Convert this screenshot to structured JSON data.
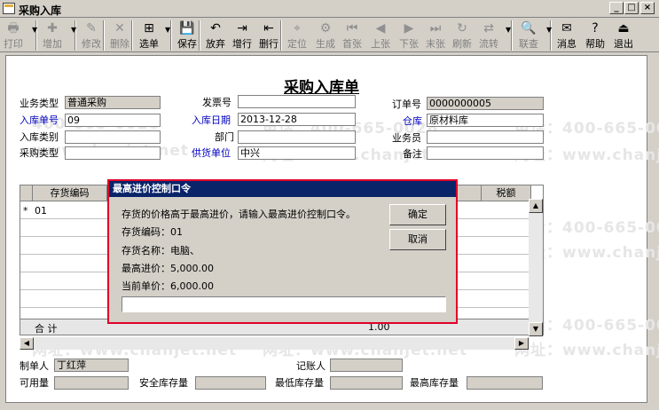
{
  "window": {
    "title": "采购入库",
    "buttons": [
      "_",
      "□",
      "×"
    ]
  },
  "toolbar": [
    {
      "label": "打印",
      "icon": "🖶",
      "enabled": false
    },
    {
      "label": "增加",
      "icon": "✚",
      "enabled": false
    },
    {
      "label": "修改",
      "icon": "✎",
      "enabled": false
    },
    {
      "label": "删除",
      "icon": "✕",
      "enabled": false
    },
    {
      "label": "选单",
      "icon": "⊞",
      "enabled": true
    },
    {
      "label": "保存",
      "icon": "💾",
      "enabled": true
    },
    {
      "label": "放弃",
      "icon": "↶",
      "enabled": true
    },
    {
      "label": "增行",
      "icon": "⇥",
      "enabled": true
    },
    {
      "label": "删行",
      "icon": "⇤",
      "enabled": true
    },
    {
      "label": "定位",
      "icon": "⌖",
      "enabled": false
    },
    {
      "label": "生成",
      "icon": "⚙",
      "enabled": false
    },
    {
      "label": "首张",
      "icon": "⏮",
      "enabled": false
    },
    {
      "label": "上张",
      "icon": "◀",
      "enabled": false
    },
    {
      "label": "下张",
      "icon": "▶",
      "enabled": false
    },
    {
      "label": "末张",
      "icon": "⏭",
      "enabled": false
    },
    {
      "label": "刷新",
      "icon": "↻",
      "enabled": false
    },
    {
      "label": "流转",
      "icon": "⇄",
      "enabled": false
    },
    {
      "label": "联查",
      "icon": "🔍",
      "enabled": false
    },
    {
      "label": "消息",
      "icon": "✉",
      "enabled": true
    },
    {
      "label": "帮助",
      "icon": "?",
      "enabled": true
    },
    {
      "label": "退出",
      "icon": "⏏",
      "enabled": true
    }
  ],
  "form": {
    "title": "采购入库单",
    "business_type_label": "业务类型",
    "business_type": "普通采购",
    "invoice_no_label": "发票号",
    "invoice_no": "",
    "order_no_label": "订单号",
    "order_no": "0000000005",
    "receipt_no_label": "入库单号",
    "receipt_no": "09",
    "receipt_date_label": "入库日期",
    "receipt_date": "2013-12-28",
    "warehouse_label": "仓库",
    "warehouse": "原材料库",
    "receipt_category_label": "入库类别",
    "receipt_category": "",
    "department_label": "部门",
    "department": "",
    "salesperson_label": "业务员",
    "salesperson": "",
    "purchase_type_label": "采购类型",
    "purchase_type": "",
    "supplier_label": "供货单位",
    "supplier": "中兴",
    "remark_label": "备注",
    "remark": ""
  },
  "grid": {
    "headers": [
      "存货编码",
      "税额"
    ],
    "first_row": {
      "marker": "*",
      "code": "01"
    },
    "total_label": "合 计",
    "total_value": "1.00"
  },
  "footer": {
    "creator_label": "制单人",
    "creator": "丁红萍",
    "bookkeeper_label": "记账人",
    "bookkeeper": "",
    "available_label": "可用量",
    "available": "",
    "safety_stock_label": "安全库存量",
    "safety_stock": "",
    "min_stock_label": "最低库存量",
    "min_stock": "",
    "max_stock_label": "最高库存量",
    "max_stock": ""
  },
  "dialog": {
    "title": "最高进价控制口令",
    "message": "存货的价格高于最高进价，请输入最高进价控制口令。",
    "line_code": "存货编码：01",
    "line_name": "存货名称：电脑、",
    "line_max_price": "最高进价：5,000.00",
    "line_current_price": "当前单价：6,000.00",
    "password_value": "",
    "ok_label": "确定",
    "cancel_label": "取消"
  },
  "watermark": {
    "phone": "电话：400-665-0028",
    "phone_short": "400-665-0028",
    "site": "网址：www.chanjet.net",
    "site_short": "www.chanjet.net",
    "site_partial": "www.chanj"
  }
}
